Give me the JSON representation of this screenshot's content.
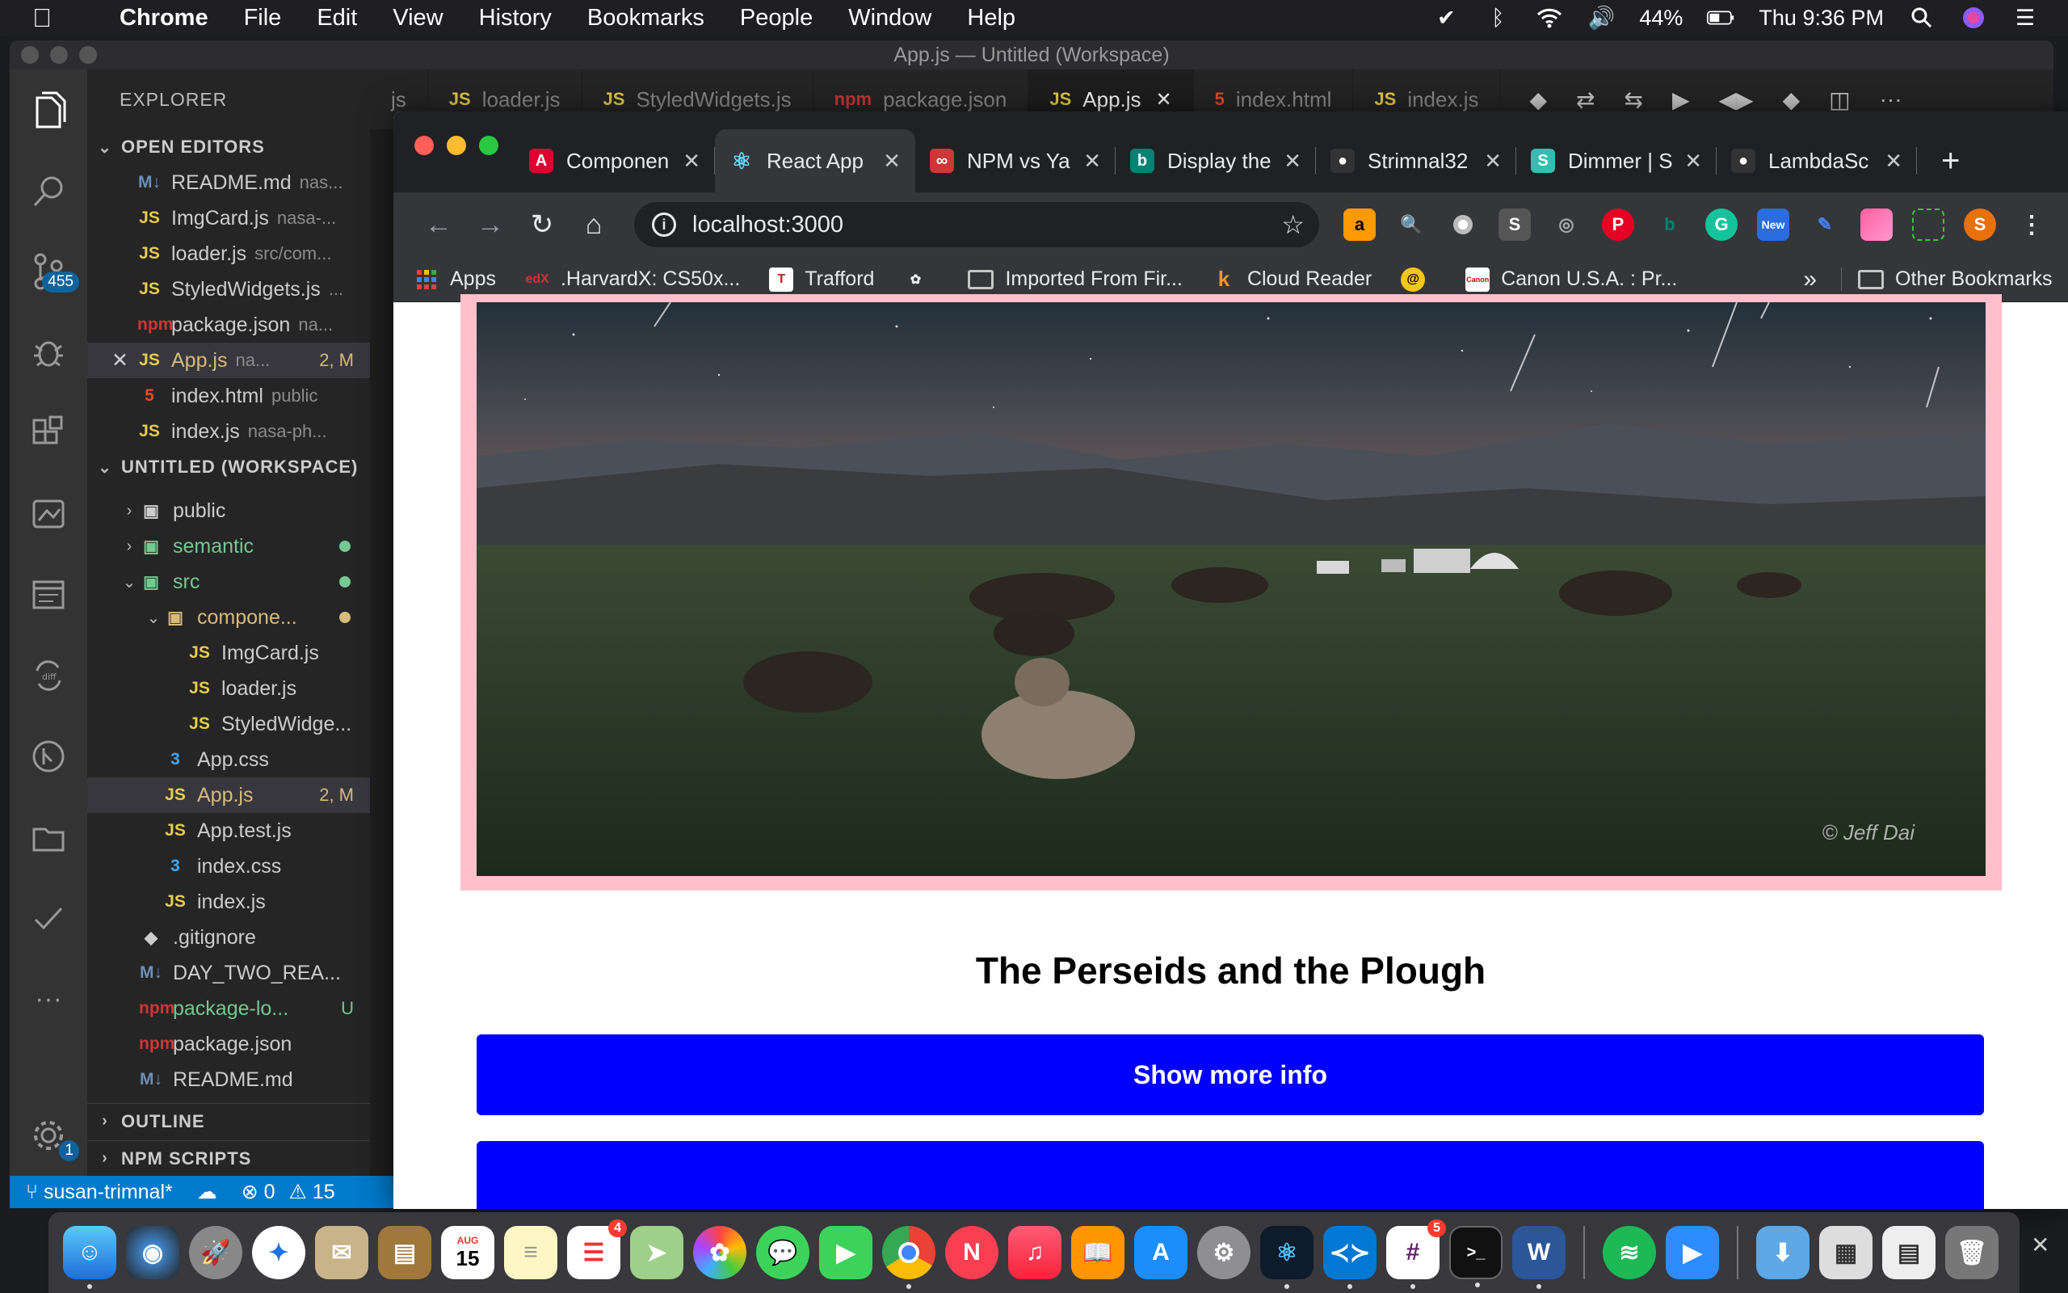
{
  "menubar": {
    "app": "Chrome",
    "items": [
      "File",
      "Edit",
      "View",
      "History",
      "Bookmarks",
      "People",
      "Window",
      "Help"
    ],
    "battery": "44%",
    "clock": "Thu 9:36 PM"
  },
  "vscode": {
    "title": "App.js — Untitled (Workspace)",
    "explorer_label": "EXPLORER",
    "scm_badge": "455",
    "settings_badge": "1",
    "open_editors_label": "OPEN EDITORS",
    "open_editors": [
      {
        "name": "README.md",
        "desc": "nas...",
        "kind": "md",
        "icon": "M↓"
      },
      {
        "name": "ImgCard.js",
        "desc": "nasa-...",
        "kind": "js",
        "icon": "JS"
      },
      {
        "name": "loader.js",
        "desc": "src/com...",
        "kind": "js",
        "icon": "JS"
      },
      {
        "name": "StyledWidgets.js",
        "desc": "...",
        "kind": "js",
        "icon": "JS"
      },
      {
        "name": "package.json",
        "desc": "na...",
        "kind": "npm",
        "icon": "npm"
      },
      {
        "name": "App.js",
        "desc": "na...",
        "kind": "js",
        "icon": "JS",
        "status": "2, M"
      },
      {
        "name": "index.html",
        "desc": "public",
        "kind": "html5",
        "icon": "5"
      },
      {
        "name": "index.js",
        "desc": "nasa-ph...",
        "kind": "js",
        "icon": "JS"
      }
    ],
    "workspace_label": "UNTITLED (WORKSPACE)",
    "tree": [
      {
        "name": "public",
        "indent": 1,
        "chevron": "›",
        "icon": "▣",
        "color": "#ccc"
      },
      {
        "name": "semantic",
        "indent": 1,
        "chevron": "›",
        "icon": "▣",
        "color": "#73c991"
      },
      {
        "name": "src",
        "indent": 1,
        "chevron": "⌄",
        "icon": "▣",
        "color": "#73c991"
      },
      {
        "name": "compone...",
        "indent": 2,
        "chevron": "⌄",
        "icon": "▣",
        "color": "#d7ba7d"
      },
      {
        "name": "ImgCard.js",
        "indent": 3,
        "icon": "JS",
        "color": "#ccc"
      },
      {
        "name": "loader.js",
        "indent": 3,
        "icon": "JS",
        "color": "#ccc"
      },
      {
        "name": "StyledWidge...",
        "indent": 3,
        "icon": "JS",
        "color": "#ccc"
      },
      {
        "name": "App.css",
        "indent": 2,
        "icon": "3",
        "color": "#ccc"
      },
      {
        "name": "App.js",
        "indent": 2,
        "icon": "JS",
        "color": "#d7ba7d",
        "status": "2, M"
      },
      {
        "name": "App.test.js",
        "indent": 2,
        "icon": "JS",
        "color": "#ccc"
      },
      {
        "name": "index.css",
        "indent": 2,
        "icon": "3",
        "color": "#ccc"
      },
      {
        "name": "index.js",
        "indent": 2,
        "icon": "JS",
        "color": "#ccc"
      },
      {
        "name": ".gitignore",
        "indent": 1,
        "icon": "◆",
        "color": "#ccc"
      },
      {
        "name": "DAY_TWO_REA...",
        "indent": 1,
        "icon": "M↓",
        "color": "#ccc"
      },
      {
        "name": "package-lo...",
        "indent": 1,
        "icon": "npm",
        "color": "#73c991",
        "status": "U"
      },
      {
        "name": "package.json",
        "indent": 1,
        "icon": "npm",
        "color": "#ccc"
      },
      {
        "name": "README.md",
        "indent": 1,
        "icon": "M↓",
        "color": "#ccc"
      }
    ],
    "outline_label": "OUTLINE",
    "npm_scripts_label": "NPM SCRIPTS",
    "editor_tabs": [
      {
        "label": "js",
        "icon": ""
      },
      {
        "label": "loader.js",
        "icon": "JS"
      },
      {
        "label": "StyledWidgets.js",
        "icon": "JS"
      },
      {
        "label": "package.json",
        "icon": "npm"
      },
      {
        "label": "App.js",
        "icon": "JS",
        "active": true
      },
      {
        "label": "index.html",
        "icon": "5"
      },
      {
        "label": "index.js",
        "icon": "JS"
      }
    ],
    "status": {
      "branch": "susan-trimnal*",
      "errors": "0",
      "warnings": "15"
    }
  },
  "chrome": {
    "tabs": [
      {
        "label": "Componen",
        "favicon": "angular-icon",
        "color": "#dd0031",
        "glyph": "A"
      },
      {
        "label": "React App",
        "favicon": "react-icon",
        "color": "#35363a",
        "glyph": "⚛",
        "active": true
      },
      {
        "label": "NPM vs Ya",
        "favicon": "npm-icon",
        "color": "#cb3837",
        "glyph": "∞"
      },
      {
        "label": "Display the",
        "favicon": "bing-icon",
        "color": "#008373",
        "glyph": "b"
      },
      {
        "label": "Strimnal32",
        "favicon": "github-icon",
        "color": "#333",
        "glyph": "●"
      },
      {
        "label": "Dimmer | S",
        "favicon": "semantic-icon",
        "color": "#35bdb2",
        "glyph": "S"
      },
      {
        "label": "LambdaSc",
        "favicon": "github-icon",
        "color": "#333",
        "glyph": "●"
      }
    ],
    "url": "localhost:3000",
    "profile_initial": "S",
    "extension_new_label": "New",
    "bookmarks": [
      {
        "label": "Apps",
        "icon": "apps-icon"
      },
      {
        "label": ".HarvardX: CS50x...",
        "icon": "edx-icon"
      },
      {
        "label": "Trafford",
        "icon": "trafford-icon"
      },
      {
        "label": "",
        "icon": "flower-icon"
      },
      {
        "label": "Imported From Fir...",
        "icon": "folder-icon"
      },
      {
        "label": "Cloud Reader",
        "icon": "kindle-icon"
      },
      {
        "label": "",
        "icon": "at-icon"
      },
      {
        "label": "Canon U.S.A. : Pr...",
        "icon": "canon-icon"
      }
    ],
    "bookmarks_overflow": "»",
    "other_bookmarks": "Other Bookmarks"
  },
  "page": {
    "photo_credit": "© Jeff Dai",
    "title": "The Perseids and the Plough",
    "show_more_label": "Show more info",
    "accent": "#0000ff",
    "frame_color": "#ffc0cb"
  },
  "dock": {
    "calendar_month": "AUG",
    "calendar_day": "15",
    "reminders_badge": "4",
    "slack_badge": "5"
  }
}
